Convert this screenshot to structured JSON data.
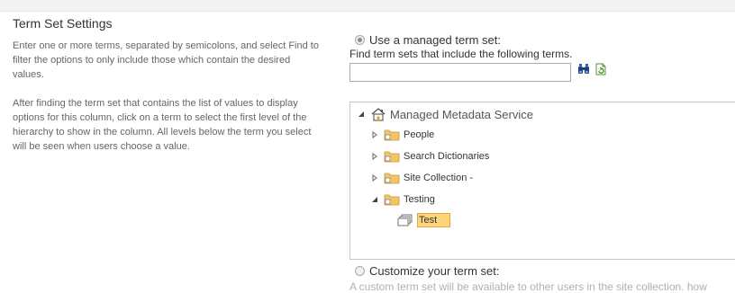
{
  "section": {
    "title": "Term Set Settings",
    "description_1": "Enter one or more terms, separated by semicolons, and select Find to filter the options to only include those which contain the desired values.",
    "description_2": "After finding the term set that contains the list of values to display options for this column, click on a term to select the first level of the hierarchy to show in the column. All levels below the term you select will be seen when users choose a value."
  },
  "managed": {
    "radio_label": "Use a managed term set:",
    "selected": true,
    "find_label": "Find term sets that include the following terms.",
    "search_value": "",
    "find_icon": "binoculars-icon",
    "browse_icon": "browse-refresh-icon"
  },
  "tree": {
    "root": {
      "label": "Managed Metadata Service",
      "icon": "home-icon",
      "expanded": true
    },
    "groups": [
      {
        "label": "People",
        "expanded": false
      },
      {
        "label": "Search Dictionaries",
        "expanded": false
      },
      {
        "label": "Site Collection -",
        "expanded": false
      },
      {
        "label": "Testing",
        "expanded": true
      }
    ],
    "selected_term": {
      "label": "Test",
      "icon": "term-set-icon"
    }
  },
  "custom": {
    "radio_label": "Customize your term set:",
    "selected": false,
    "description": "A custom term set will be available to other users in the site collection. how"
  },
  "colors": {
    "selection_fill": "#ffd47a",
    "selection_border": "#e3a83c",
    "folder": "#f0c060"
  }
}
